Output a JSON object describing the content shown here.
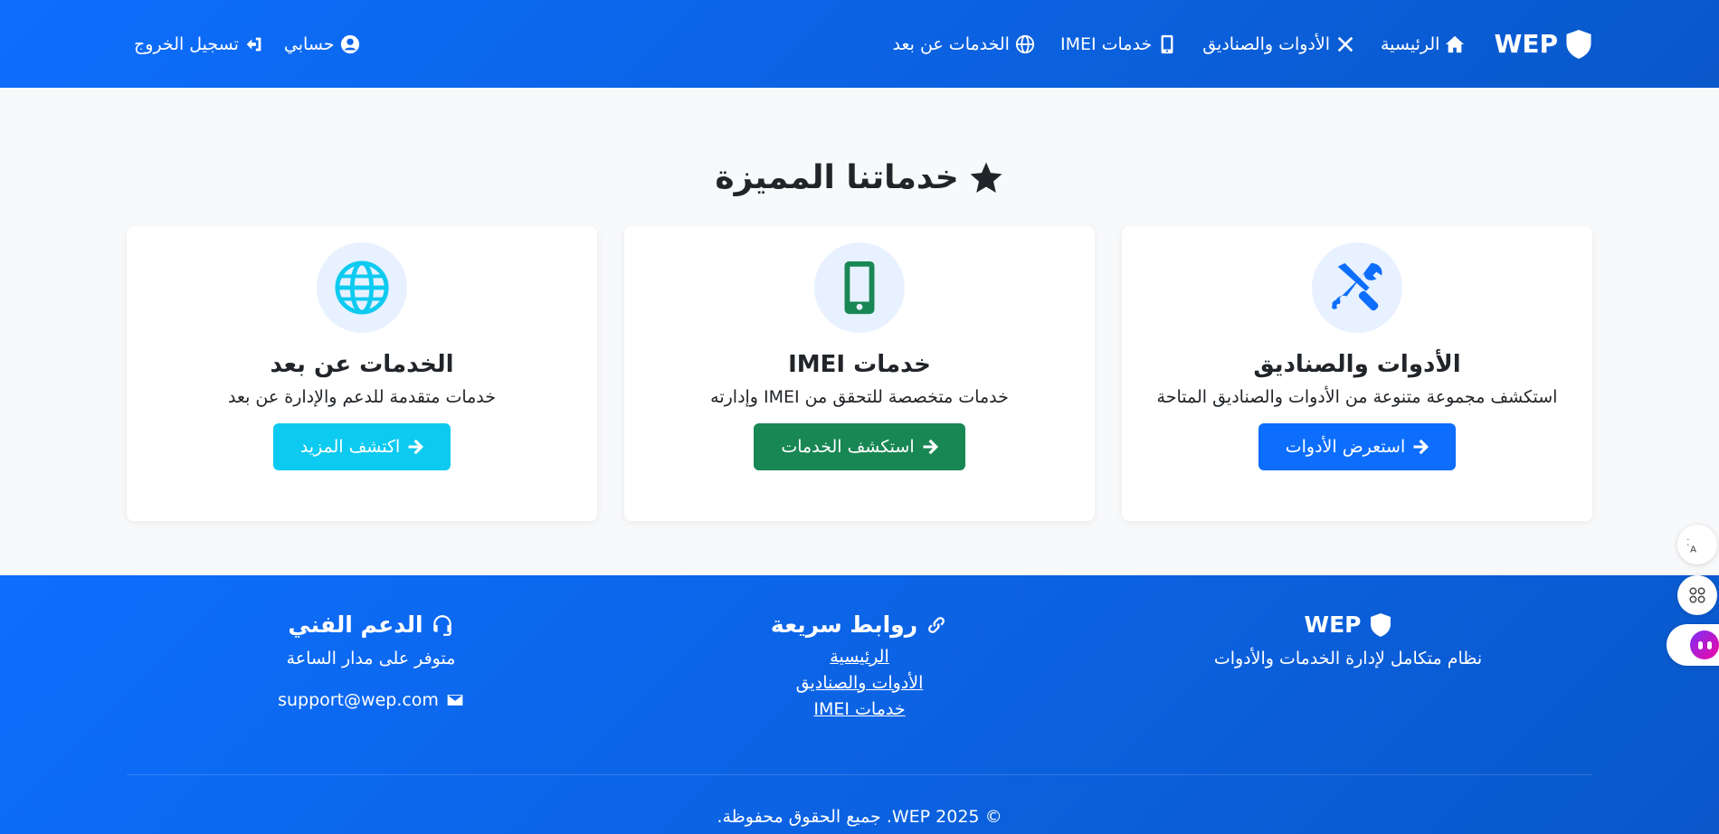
{
  "header": {
    "brand": "WEP",
    "nav": [
      {
        "label": "الرئيسية",
        "icon": "home-icon"
      },
      {
        "label": "الأدوات والصناديق",
        "icon": "tools-icon"
      },
      {
        "label": "خدمات IMEI",
        "icon": "mobile-icon"
      },
      {
        "label": "الخدمات عن بعد",
        "icon": "globe-icon"
      }
    ],
    "account_label": "حسابي",
    "logout_label": "تسجيل الخروج"
  },
  "main": {
    "section_title": "خدماتنا المميزة",
    "cards": [
      {
        "title": "الأدوات والصناديق",
        "description": "استكشف مجموعة متنوعة من الأدوات والصناديق المتاحة",
        "button": "استعرض الأدوات",
        "icon": "tools-icon",
        "color": "#0d6efd"
      },
      {
        "title": "خدمات IMEI",
        "description": "خدمات متخصصة للتحقق من IMEI وإدارته",
        "button": "استكشف الخدمات",
        "icon": "mobile-icon",
        "color": "#198754"
      },
      {
        "title": "الخدمات عن بعد",
        "description": "خدمات متقدمة للدعم والإدارة عن بعد",
        "button": "اكتشف المزيد",
        "icon": "globe-icon",
        "color": "#0dcaf0"
      }
    ]
  },
  "footer": {
    "about": {
      "heading": "WEP",
      "text": "نظام متكامل لإدارة الخدمات والأدوات"
    },
    "quick_links": {
      "heading": "روابط سريعة",
      "links": [
        "الرئيسية",
        "الأدوات والصناديق",
        "خدمات IMEI"
      ]
    },
    "support": {
      "heading": "الدعم الفني",
      "text": "متوفر على مدار الساعة",
      "email": "support@wep.com"
    },
    "copyright": "© 2025 WEP. جميع الحقوق محفوظة."
  },
  "colors": {
    "brand": "#0d6efd",
    "brand_dark": "#0a58ca",
    "success": "#198754",
    "info": "#0dcaf0",
    "page_bg": "#f8f9fa"
  }
}
